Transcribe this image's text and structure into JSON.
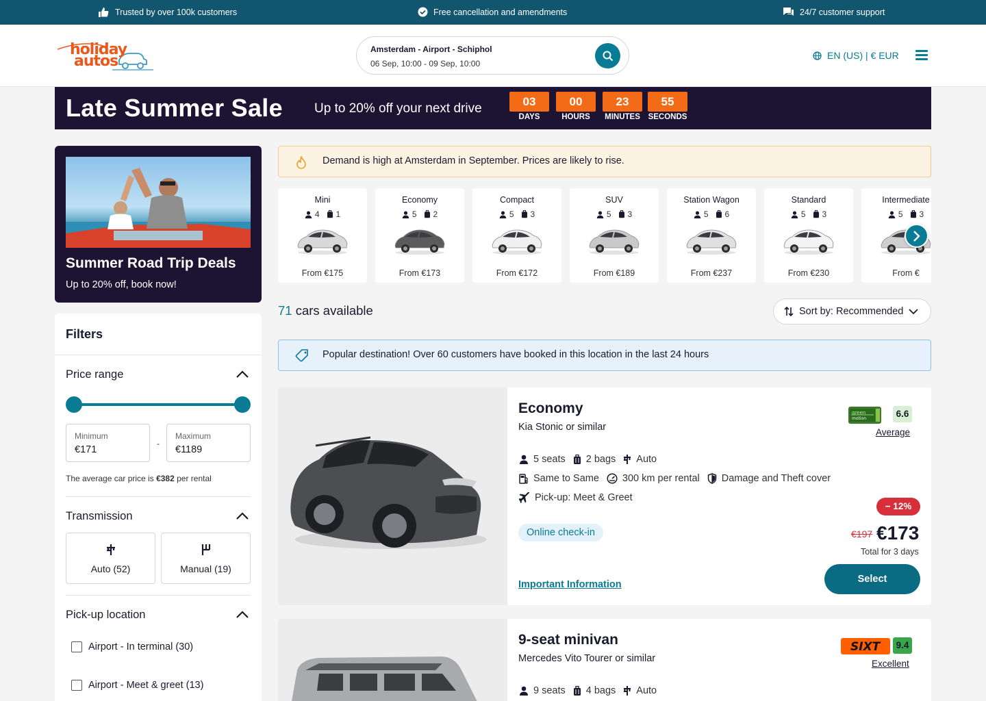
{
  "topbar": {
    "trusted": "Trusted by over 100k customers",
    "cancellation": "Free cancellation and amendments",
    "support": "24/7 customer support"
  },
  "header": {
    "logo_line1": "holiday",
    "logo_line2": "autos",
    "search_location": "Amsterdam - Airport - Schiphol",
    "search_dates": "06 Sep, 10:00 - 09 Sep, 10:00",
    "locale": "EN (US) | € EUR"
  },
  "sale": {
    "title": "Late Summer Sale",
    "subtitle": "Up to 20% off your next drive",
    "countdown": [
      {
        "value": "03",
        "label": "DAYS"
      },
      {
        "value": "00",
        "label": "HOURS"
      },
      {
        "value": "23",
        "label": "MINUTES"
      },
      {
        "value": "55",
        "label": "SECONDS"
      }
    ]
  },
  "promo": {
    "title": "Summer Road Trip Deals",
    "subtitle": "Up to 20% off, book now!"
  },
  "filters": {
    "title": "Filters",
    "price": {
      "title": "Price range",
      "min_label": "Minimum",
      "min_value": "€171",
      "max_label": "Maximum",
      "max_value": "€1189",
      "separator": "-",
      "avg_prefix": "The average car price is ",
      "avg_value": "€382",
      "avg_suffix": " per rental"
    },
    "transmission": {
      "title": "Transmission",
      "auto": "Auto (52)",
      "manual": "Manual (19)"
    },
    "pickup": {
      "title": "Pick-up location",
      "options": [
        "Airport - In terminal (30)",
        "Airport - Meet & greet (13)"
      ]
    }
  },
  "demand_notice": "Demand is high at Amsterdam in September. Prices are likely to rise.",
  "categories": [
    {
      "name": "Mini",
      "seats": "4",
      "bags": "1",
      "price": "From €175",
      "color": "#d8d8d8"
    },
    {
      "name": "Economy",
      "seats": "5",
      "bags": "2",
      "price": "From €173",
      "color": "#5b5b5b"
    },
    {
      "name": "Compact",
      "seats": "5",
      "bags": "3",
      "price": "From €172",
      "color": "#f0f0f0"
    },
    {
      "name": "SUV",
      "seats": "5",
      "bags": "3",
      "price": "From €189",
      "color": "#c9c9c9"
    },
    {
      "name": "Station Wagon",
      "seats": "5",
      "bags": "6",
      "price": "From €237",
      "color": "#e0e0e0"
    },
    {
      "name": "Standard",
      "seats": "5",
      "bags": "3",
      "price": "From €230",
      "color": "#f4f4f4"
    },
    {
      "name": "Intermediate",
      "seats": "5",
      "bags": "3",
      "price": "From €",
      "color": "#cfcfcf"
    }
  ],
  "results": {
    "count": "71",
    "count_suffix": " cars available",
    "sort_label": "Sort by: Recommended"
  },
  "popular_notice": "Popular destination! Over 60 customers have booked in this location in the last 24 hours",
  "cars": [
    {
      "class": "Economy",
      "model": "Kia Stonic or similar",
      "seats": "5 seats",
      "bags": "2 bags",
      "transmission": "Auto",
      "fuel_policy": "Same to Same",
      "mileage": "300 km per rental",
      "cover": "Damage and Theft cover",
      "pickup": "Pick-up: Meet & Greet",
      "checkin": "Online check-in",
      "important": "Important Information",
      "supplier": "green motion",
      "rating": "6.6",
      "rating_label": "Average",
      "discount": "− 12%",
      "old_price": "€197",
      "price": "€173",
      "total": "Total for 3 days",
      "select": "Select",
      "accent": "#6ab04c"
    },
    {
      "class": "9-seat minivan",
      "model": "Mercedes Vito Tourer or similar",
      "seats": "9 seats",
      "bags": "4 bags",
      "transmission": "Auto",
      "supplier": "SIXT",
      "rating": "9.4",
      "rating_label": "Excellent",
      "accent": "#ff5f00"
    }
  ]
}
